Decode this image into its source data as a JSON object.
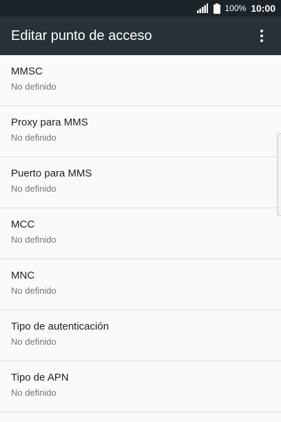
{
  "status_bar": {
    "battery": "100%",
    "time": "10:00",
    "icons": [
      "signal-icon",
      "battery-icon"
    ]
  },
  "app_bar": {
    "title": "Editar punto de acceso",
    "menu_icon": "more-vert-icon"
  },
  "settings": {
    "items": [
      {
        "title": "MMSC",
        "value": "No definido"
      },
      {
        "title": "Proxy para MMS",
        "value": "No definido"
      },
      {
        "title": "Puerto para MMS",
        "value": "No definido"
      },
      {
        "title": "MCC",
        "value": "No definido"
      },
      {
        "title": "MNC",
        "value": "No definido"
      },
      {
        "title": "Tipo de autenticación",
        "value": "No definido"
      },
      {
        "title": "Tipo de APN",
        "value": "No definido"
      }
    ]
  },
  "colors": {
    "status_bar": "#1c2329",
    "app_bar": "#263238",
    "background": "#fafafa",
    "primary_text": "#212121",
    "secondary_text": "#757575",
    "divider": "#dcdcdc"
  }
}
